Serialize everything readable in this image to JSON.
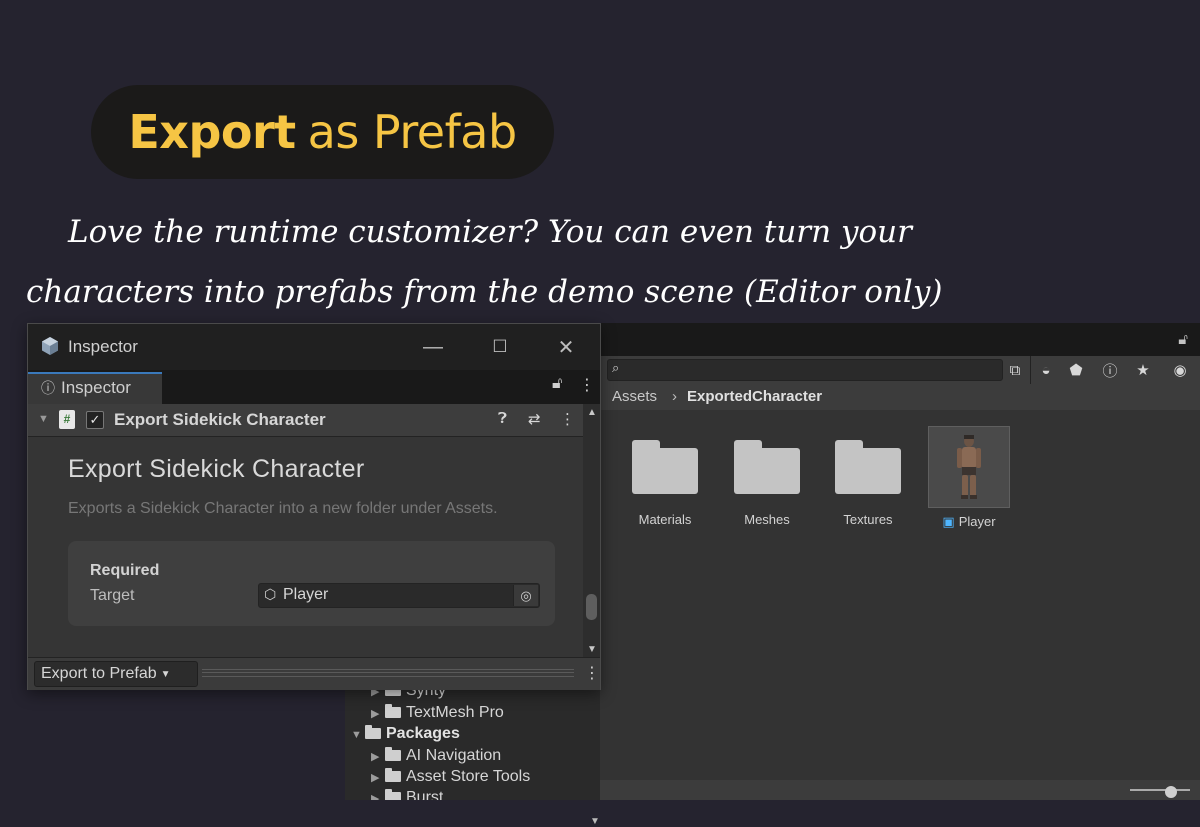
{
  "headline": {
    "bold": "Export",
    "rest": "as Prefab"
  },
  "tagline": {
    "line1": "Love the runtime customizer? You can even turn your",
    "line2": "characters into prefabs from the demo scene (Editor only)"
  },
  "inspector_window": {
    "title": "Inspector",
    "tab_label": "Inspector",
    "component": {
      "name": "Export Sidekick Character",
      "enabled": true,
      "heading": "Export Sidekick Character",
      "description": "Exports a Sidekick Character into a new folder under Assets.",
      "section_label": "Required",
      "target_label": "Target",
      "target_value": "Player"
    },
    "footer": {
      "button_label": "Export to Prefab"
    }
  },
  "project_window": {
    "breadcrumb": [
      "Assets",
      "ExportedCharacter"
    ],
    "assets": [
      {
        "name": "Materials",
        "kind": "folder"
      },
      {
        "name": "Meshes",
        "kind": "folder"
      },
      {
        "name": "Textures",
        "kind": "folder"
      },
      {
        "name": "Player",
        "kind": "prefab"
      }
    ],
    "tree": [
      {
        "label": "Synty",
        "bold": false
      },
      {
        "label": "TextMesh Pro",
        "bold": false
      },
      {
        "label": "Packages",
        "bold": true
      },
      {
        "label": "AI Navigation",
        "bold": false
      },
      {
        "label": "Asset Store Tools",
        "bold": false
      },
      {
        "label": "Burst",
        "bold": false
      }
    ]
  },
  "colors": {
    "background": "#25232f",
    "accent_yellow": "#f6c544",
    "pill": "#1b1a19",
    "prefab_blue": "#4fb6ff"
  }
}
